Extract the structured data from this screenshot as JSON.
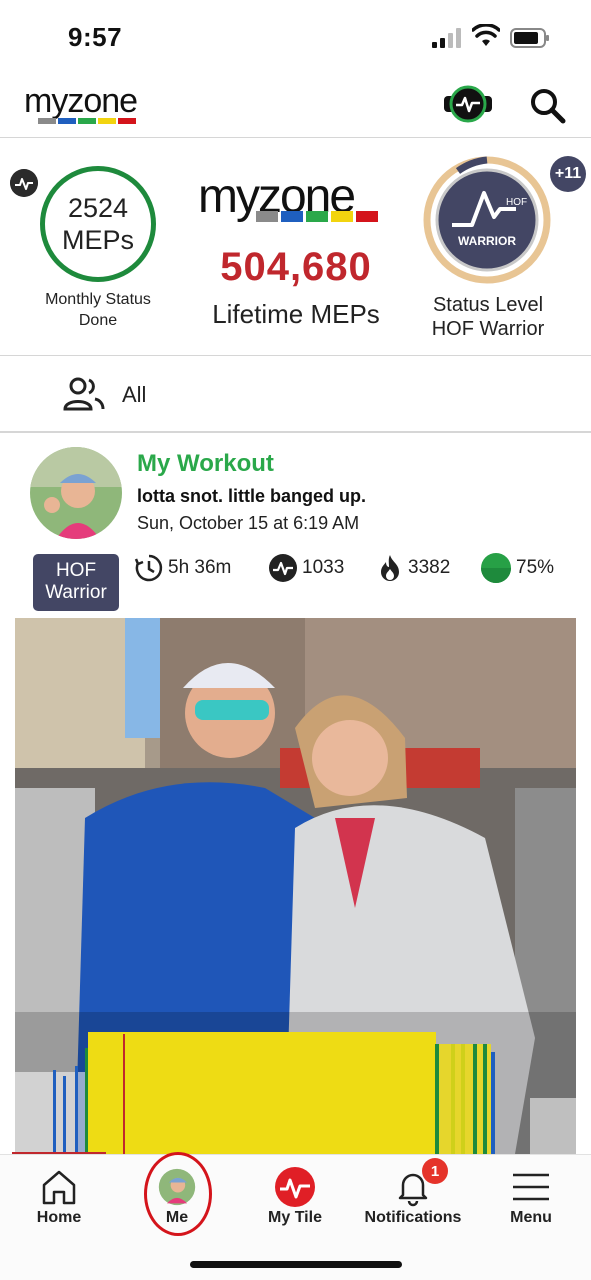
{
  "status_bar": {
    "time": "9:57"
  },
  "header": {
    "logo_text": "myzone",
    "belt_icon": "heart-rate-belt-icon",
    "search_icon": "search-icon"
  },
  "colors": {
    "brand_red": "#c0272d",
    "brand_green": "#2aa84a",
    "ring_green": "#1e8a3c",
    "badge_navy": "#434664",
    "logo_bars": [
      "#8a8a8a",
      "#1f5fbf",
      "#2aa84a",
      "#f2d40f",
      "#d4141b"
    ]
  },
  "stats": {
    "monthly": {
      "value": "2524",
      "unit": "MEPs",
      "status_line1": "Monthly Status",
      "status_line2": "Done"
    },
    "lifetime": {
      "value": "504,680",
      "label": "Lifetime MEPs"
    },
    "status_level": {
      "line1": "Status Level",
      "line2": "HOF Warrior",
      "badge_top": "HOF",
      "badge_bottom": "WARRIOR",
      "extra_count": "+11"
    }
  },
  "filter": {
    "label": "All",
    "icon": "people-icon"
  },
  "workout": {
    "title": "My Workout",
    "note": "lotta snot. little banged up.",
    "date": "Sun, October 15 at 6:19 AM",
    "badge_line1": "HOF",
    "badge_line2": "Warrior",
    "metrics": {
      "duration": "5h 36m",
      "meps": "1033",
      "calories": "3382",
      "effort": "75%"
    }
  },
  "tabs": [
    {
      "label": "Home",
      "icon": "home-icon"
    },
    {
      "label": "Me",
      "icon": "avatar-icon"
    },
    {
      "label": "My Tile",
      "icon": "my-tile-icon"
    },
    {
      "label": "Notifications",
      "icon": "bell-icon",
      "badge": "1"
    },
    {
      "label": "Menu",
      "icon": "hamburger-menu-icon"
    }
  ]
}
